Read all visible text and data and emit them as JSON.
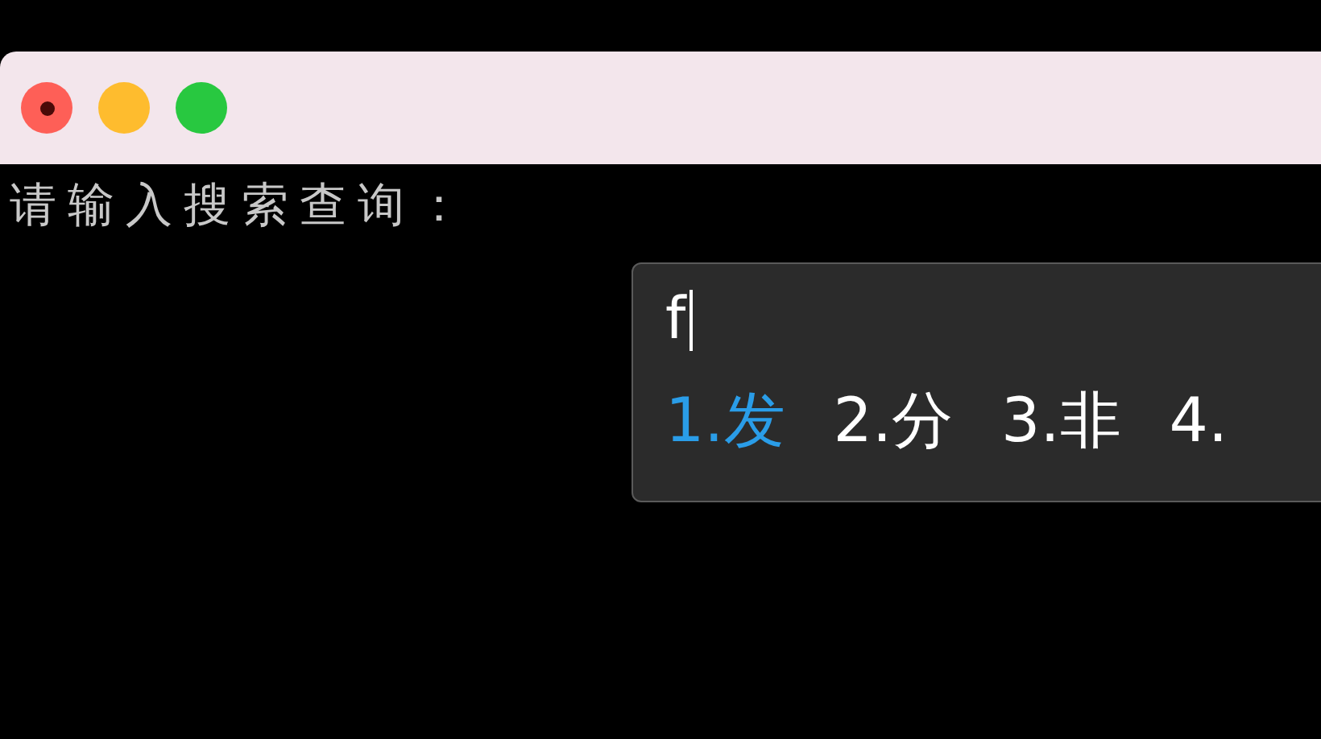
{
  "window": {
    "controls": [
      {
        "kind": "close"
      },
      {
        "kind": "minimize"
      },
      {
        "kind": "zoom"
      }
    ]
  },
  "terminal": {
    "prompt": "请输入搜索查询："
  },
  "ime": {
    "composition": "f",
    "candidates": [
      {
        "label": "1.发",
        "selected": true
      },
      {
        "label": "2.分",
        "selected": false
      },
      {
        "label": "3.非",
        "selected": false
      },
      {
        "label": "4.",
        "selected": false
      }
    ]
  }
}
